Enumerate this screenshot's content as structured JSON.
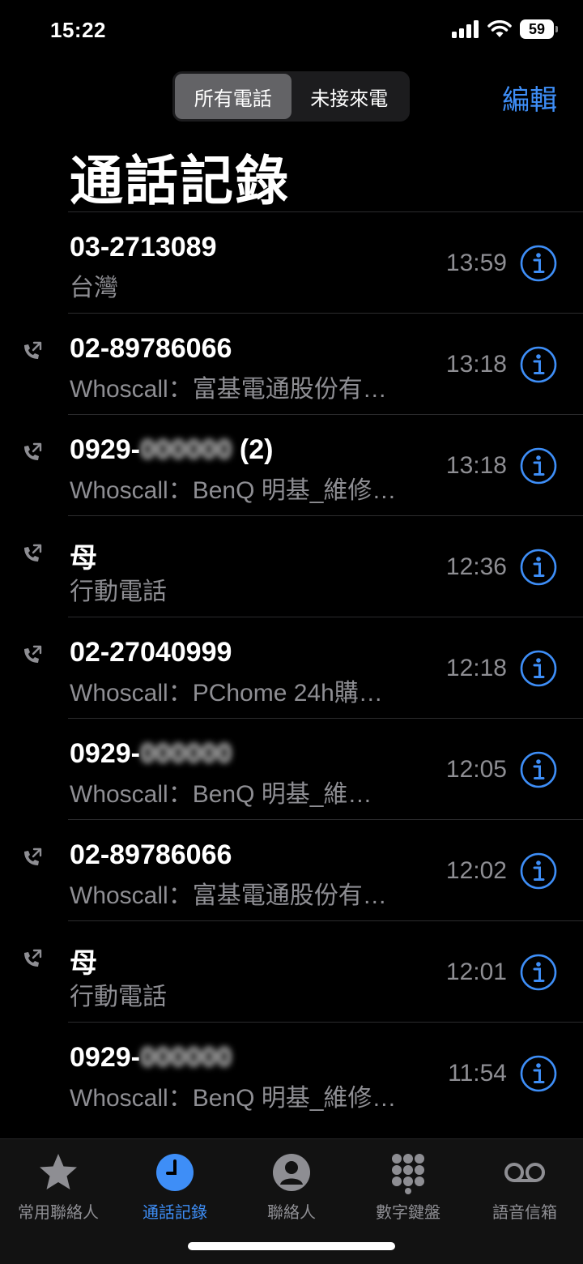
{
  "status": {
    "time": "15:22",
    "battery": "59"
  },
  "segment": {
    "all": "所有電話",
    "missed": "未接來電"
  },
  "header": {
    "edit": "編輯",
    "title": "通話記錄"
  },
  "calls": [
    {
      "name": "03-2713089",
      "sub": "台灣",
      "time": "13:59",
      "outgoing": false
    },
    {
      "name": "02-89786066",
      "sub": "Whoscall：富基電通股份有…",
      "time": "13:18",
      "outgoing": true
    },
    {
      "name_prefix": "0929-",
      "name_hidden": "000000",
      "name_suffix": " (2)",
      "sub": "Whoscall：BenQ 明基_維修…",
      "time": "13:18",
      "outgoing": true
    },
    {
      "name": "母",
      "sub": "行動電話",
      "time": "12:36",
      "outgoing": true
    },
    {
      "name": "02-27040999",
      "sub": "Whoscall：PChome 24h購…",
      "time": "12:18",
      "outgoing": true
    },
    {
      "name_prefix": "0929-",
      "name_hidden": "000000",
      "name_suffix": "",
      "sub": "Whoscall：BenQ 明基_維…",
      "time": "12:05",
      "outgoing": false
    },
    {
      "name": "02-89786066",
      "sub": "Whoscall：富基電通股份有…",
      "time": "12:02",
      "outgoing": true
    },
    {
      "name": "母",
      "sub": "行動電話",
      "time": "12:01",
      "outgoing": true
    },
    {
      "name_prefix": "0929-",
      "name_hidden": "000000",
      "name_suffix": "",
      "sub": "Whoscall：BenQ 明基_維修…",
      "time": "11:54",
      "outgoing": false
    }
  ],
  "tabs": [
    {
      "label": "常用聯絡人",
      "icon": "star-icon",
      "active": false
    },
    {
      "label": "通話記錄",
      "icon": "clock-icon",
      "active": true
    },
    {
      "label": "聯絡人",
      "icon": "person-icon",
      "active": false
    },
    {
      "label": "數字鍵盤",
      "icon": "keypad-icon",
      "active": false
    },
    {
      "label": "語音信箱",
      "icon": "voicemail-icon",
      "active": false
    }
  ],
  "colors": {
    "accent": "#3e8ef7",
    "secondary": "#8e8e93"
  }
}
